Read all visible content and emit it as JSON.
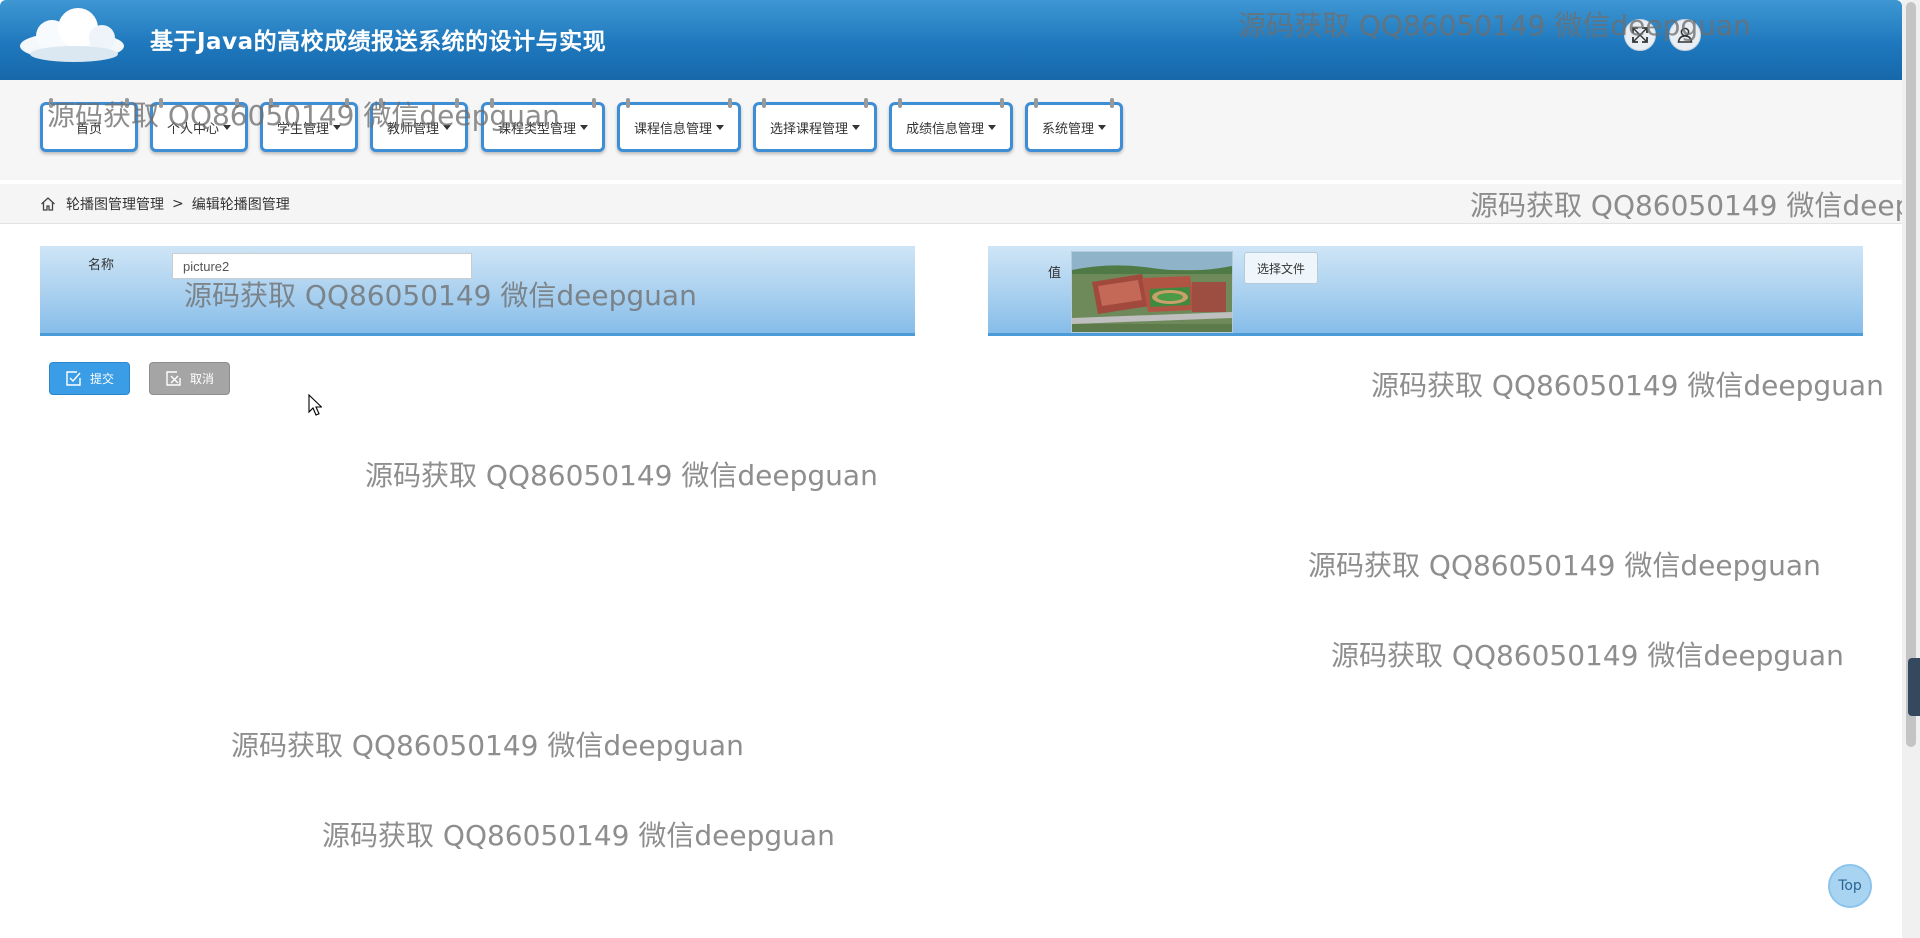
{
  "header": {
    "title": "基于Java的高校成绩报送系统的设计与实现",
    "fullscreen_icon": "expand-icon",
    "user_icon": "user-icon"
  },
  "nav": {
    "items": [
      {
        "label": "首页",
        "dropdown": false
      },
      {
        "label": "个人中心",
        "dropdown": true
      },
      {
        "label": "学生管理",
        "dropdown": true
      },
      {
        "label": "教师管理",
        "dropdown": true
      },
      {
        "label": "课程类型管理",
        "dropdown": true
      },
      {
        "label": "课程信息管理",
        "dropdown": true
      },
      {
        "label": "选择课程管理",
        "dropdown": true
      },
      {
        "label": "成绩信息管理",
        "dropdown": true
      },
      {
        "label": "系统管理",
        "dropdown": true
      }
    ]
  },
  "breadcrumb": {
    "parent": "轮播图管理管理",
    "separator": ">",
    "current": "编辑轮播图管理"
  },
  "form": {
    "name_label": "名称",
    "name_value": "picture2",
    "value_label": "值",
    "choose_file_label": "选择文件",
    "thumbnail_alt": "campus-photo"
  },
  "actions": {
    "submit_label": "提交",
    "cancel_label": "取消"
  },
  "back_to_top": "Top",
  "watermark_text": "源码获取 QQ86050149 微信deepguan",
  "colors": {
    "header_blue": "#1f78bd",
    "nav_border": "#3d8ed5",
    "panel_blue": "#a9d0ef",
    "submit_blue": "#3a9de6",
    "cancel_gray": "#a5a5a5"
  }
}
